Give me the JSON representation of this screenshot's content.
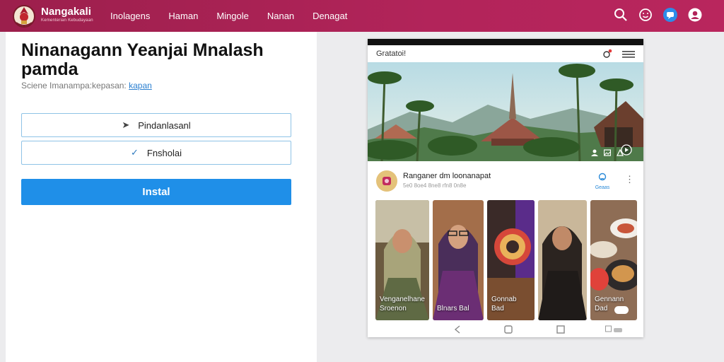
{
  "header": {
    "brand": "Nangakali",
    "brand_sub": "Kementerian Kebudayaan",
    "nav": [
      "Inolagens",
      "Haman",
      "Mingole",
      "Nanan",
      "Denagat"
    ],
    "icons": [
      "search-icon",
      "smiley-icon",
      "chat-icon",
      "account-icon"
    ],
    "colors": {
      "bar": "#b2245a",
      "chat_badge": "#2d8ce8"
    }
  },
  "form": {
    "title": "Ninanagann Yeanjai Mnalash pamda",
    "subtitle": "Sciene Imanampa:kepasan:",
    "subtitle_link": "kapan",
    "option1": {
      "glyph": "➤",
      "label": "Pindanlasanl"
    },
    "option2": {
      "glyph": "✓",
      "label": "Fnsholai"
    },
    "install_label": "Instal",
    "colors": {
      "install": "#1f8fe8",
      "option_border": "#8fc3e6"
    }
  },
  "phone": {
    "app_title": "Gratatoi!",
    "icons": [
      "bell-icon",
      "menu-icon"
    ],
    "hero_icons": [
      "user-icon",
      "image-icon",
      "share-icon",
      "play-icon"
    ],
    "post": {
      "author": "Ranganer dm loonanapat",
      "meta": "5e0 8oe4 8ne8 rfn8 0n8e",
      "follow_label": "Geaas"
    },
    "cards": [
      {
        "line1": "Venganelhane",
        "line2": "Sroenon"
      },
      {
        "line1": "Blnars Bal",
        "line2": ""
      },
      {
        "line1": "Gonnab",
        "line2": "Bad"
      },
      {
        "line1": "",
        "line2": ""
      },
      {
        "line1": "Gennann",
        "line2": "Dad"
      }
    ],
    "nav_icons": [
      "back-icon",
      "home-icon",
      "recents-icon",
      "keyboard-icon"
    ]
  }
}
